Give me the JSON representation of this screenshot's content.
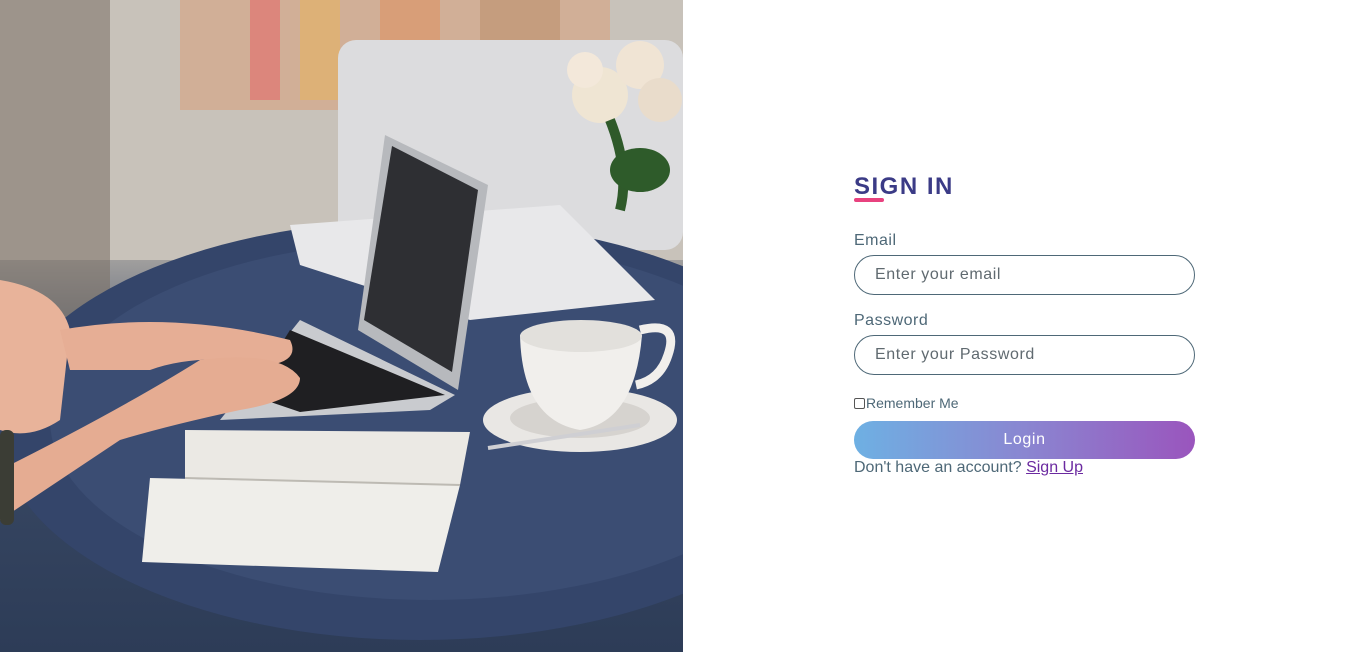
{
  "signin": {
    "title": "SIGN IN",
    "email_label": "Email",
    "email_placeholder": "Enter your email",
    "password_label": "Password",
    "password_placeholder": "Enter your Password",
    "remember_label": "Remember Me",
    "login_label": "Login",
    "no_account_text": "Don't have an account?",
    "signup_label": "Sign Up"
  },
  "colors": {
    "title": "#3b3b86",
    "title_underline": "#e8427f",
    "label": "#4e6877",
    "login_gradient_start": "#6eb0e3",
    "login_gradient_end": "#9a55bd",
    "signup_link": "#6b2aa0"
  },
  "icons": {
    "hero_image": "desk-laptop-photo",
    "checkbox": "checkbox-unchecked"
  }
}
